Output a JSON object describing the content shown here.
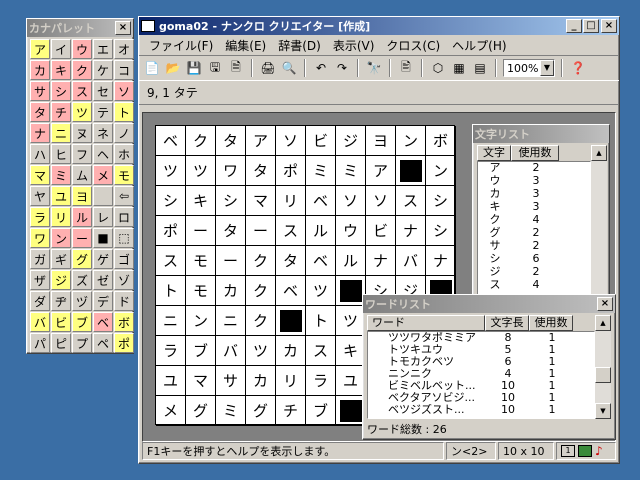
{
  "palette": {
    "title": "カナパレット",
    "close": "×",
    "keys": [
      {
        "t": "ア",
        "c": "yel"
      },
      {
        "t": "イ",
        "c": ""
      },
      {
        "t": "ウ",
        "c": "pink"
      },
      {
        "t": "エ",
        "c": ""
      },
      {
        "t": "オ",
        "c": ""
      },
      {
        "t": "カ",
        "c": "pink"
      },
      {
        "t": "キ",
        "c": "pink"
      },
      {
        "t": "ク",
        "c": "pink"
      },
      {
        "t": "ケ",
        "c": ""
      },
      {
        "t": "コ",
        "c": ""
      },
      {
        "t": "サ",
        "c": "pink"
      },
      {
        "t": "シ",
        "c": "pink"
      },
      {
        "t": "ス",
        "c": "pink"
      },
      {
        "t": "セ",
        "c": ""
      },
      {
        "t": "ソ",
        "c": "pink"
      },
      {
        "t": "タ",
        "c": "pink"
      },
      {
        "t": "チ",
        "c": "pink"
      },
      {
        "t": "ツ",
        "c": "yel"
      },
      {
        "t": "テ",
        "c": ""
      },
      {
        "t": "ト",
        "c": "yel"
      },
      {
        "t": "ナ",
        "c": "pink"
      },
      {
        "t": "ニ",
        "c": "yel"
      },
      {
        "t": "ヌ",
        "c": ""
      },
      {
        "t": "ネ",
        "c": ""
      },
      {
        "t": "ノ",
        "c": ""
      },
      {
        "t": "ハ",
        "c": ""
      },
      {
        "t": "ヒ",
        "c": ""
      },
      {
        "t": "フ",
        "c": ""
      },
      {
        "t": "ヘ",
        "c": ""
      },
      {
        "t": "ホ",
        "c": ""
      },
      {
        "t": "マ",
        "c": "yel"
      },
      {
        "t": "ミ",
        "c": "pink"
      },
      {
        "t": "ム",
        "c": ""
      },
      {
        "t": "メ",
        "c": "pink"
      },
      {
        "t": "モ",
        "c": "yel"
      },
      {
        "t": "ヤ",
        "c": ""
      },
      {
        "t": "ユ",
        "c": "yel"
      },
      {
        "t": "ヨ",
        "c": "yel"
      },
      {
        "t": "",
        "c": ""
      },
      {
        "t": "⇦",
        "c": ""
      },
      {
        "t": "ラ",
        "c": "yel"
      },
      {
        "t": "リ",
        "c": "yel"
      },
      {
        "t": "ル",
        "c": "pink"
      },
      {
        "t": "レ",
        "c": ""
      },
      {
        "t": "ロ",
        "c": ""
      },
      {
        "t": "ワ",
        "c": "yel"
      },
      {
        "t": "ン",
        "c": "pink"
      },
      {
        "t": "ー",
        "c": "pink"
      },
      {
        "t": "■",
        "c": ""
      },
      {
        "t": "⬚",
        "c": ""
      },
      {
        "t": "ガ",
        "c": ""
      },
      {
        "t": "ギ",
        "c": ""
      },
      {
        "t": "グ",
        "c": "yel"
      },
      {
        "t": "ゲ",
        "c": ""
      },
      {
        "t": "ゴ",
        "c": ""
      },
      {
        "t": "ザ",
        "c": ""
      },
      {
        "t": "ジ",
        "c": "yel"
      },
      {
        "t": "ズ",
        "c": ""
      },
      {
        "t": "ゼ",
        "c": ""
      },
      {
        "t": "ゾ",
        "c": ""
      },
      {
        "t": "ダ",
        "c": ""
      },
      {
        "t": "ヂ",
        "c": ""
      },
      {
        "t": "ヅ",
        "c": ""
      },
      {
        "t": "デ",
        "c": ""
      },
      {
        "t": "ド",
        "c": ""
      },
      {
        "t": "バ",
        "c": "yel"
      },
      {
        "t": "ビ",
        "c": "yel"
      },
      {
        "t": "ブ",
        "c": "yel"
      },
      {
        "t": "ベ",
        "c": "pink"
      },
      {
        "t": "ボ",
        "c": "yel"
      },
      {
        "t": "パ",
        "c": ""
      },
      {
        "t": "ピ",
        "c": ""
      },
      {
        "t": "プ",
        "c": ""
      },
      {
        "t": "ペ",
        "c": ""
      },
      {
        "t": "ポ",
        "c": "yel"
      }
    ]
  },
  "main": {
    "title": "goma02 - ナンクロ クリエイター [作成]",
    "menu": [
      "ファイル(F)",
      "編集(E)",
      "辞書(D)",
      "表示(V)",
      "クロス(C)",
      "ヘルプ(H)"
    ],
    "toolbar_icons": [
      "📄",
      "📂",
      "💾",
      "🖫",
      "🗎",
      "🖨",
      "🔍",
      "↶",
      "↷",
      "🔭",
      "🖹",
      "⬡",
      "▦",
      "▤",
      "❓"
    ],
    "zoom": "100%",
    "position": "9, 1  タテ",
    "status_help": "F1キーを押すとヘルプを表示します。",
    "status_word": "ン<2>",
    "status_size": "10 x 10",
    "grid": [
      "ベクタアソビジヨンボ",
      "ツツワタポミミア■ン",
      "シキシマリベソソスシ",
      "ポータースルウビナシ",
      "スモークタベルナバナ",
      "トモカクベツ■シジ■",
      "ニンニク■トツ",
      "ラブバツカスキ",
      "ユマサカリラユ",
      "メグミグチブ■"
    ]
  },
  "charlist": {
    "title": "文字リスト",
    "headers": [
      "文字",
      "使用数"
    ],
    "rows": [
      [
        "ア",
        "2"
      ],
      [
        "ウ",
        "3"
      ],
      [
        "カ",
        "3"
      ],
      [
        "キ",
        "3"
      ],
      [
        "ク",
        "4"
      ],
      [
        "グ",
        "2"
      ],
      [
        "サ",
        "2"
      ],
      [
        "シ",
        "6"
      ],
      [
        "ジ",
        "2"
      ],
      [
        "ス",
        "4"
      ]
    ]
  },
  "wordlist": {
    "title": "ワードリスト",
    "headers": [
      "ワード",
      "文字長",
      "使用数"
    ],
    "rows": [
      [
        "ツツワタポミミア",
        "8",
        "1"
      ],
      [
        "トツキユウ",
        "5",
        "1"
      ],
      [
        "トモカクベツ",
        "6",
        "1"
      ],
      [
        "ニンニク",
        "4",
        "1"
      ],
      [
        "ビミベルベット...",
        "10",
        "1"
      ],
      [
        "ベクタアソビジ...",
        "10",
        "1"
      ],
      [
        "ベツジズスト...",
        "10",
        "1"
      ]
    ],
    "total": "ワード総数 : 26"
  }
}
